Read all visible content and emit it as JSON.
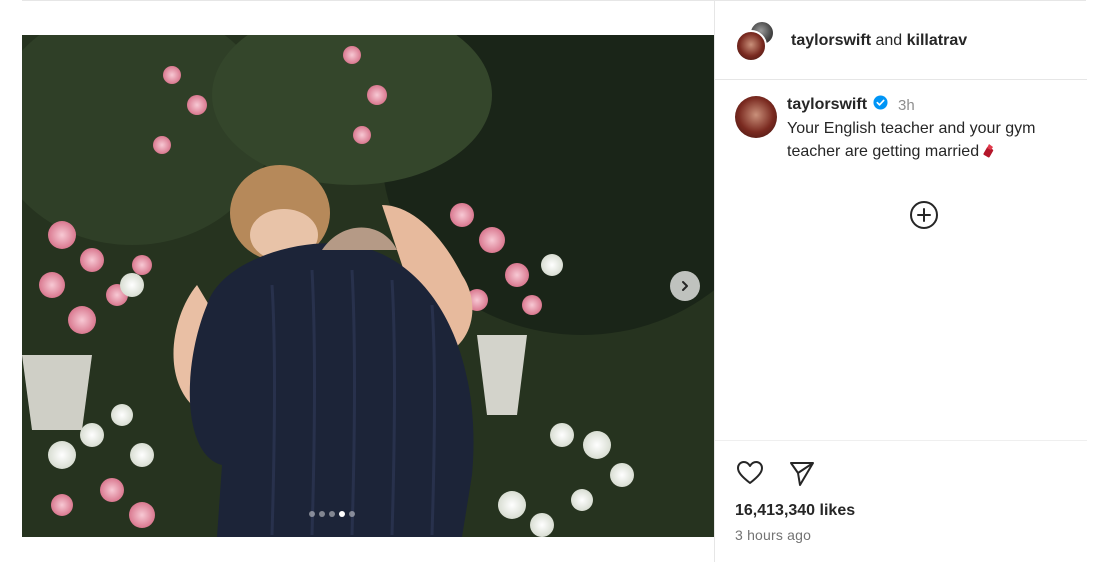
{
  "header": {
    "user1": "taylorswift",
    "conjunction": "and",
    "user2": "killatrav"
  },
  "caption": {
    "username": "taylorswift",
    "verified_icon": "verified-badge-icon",
    "time": "3h",
    "text": "Your English teacher and your gym teacher are getting married",
    "emoji_icon": "lipstick-emoji-icon"
  },
  "media": {
    "carousel_count": 5,
    "carousel_active_index": 3,
    "next_icon": "chevron-right-icon"
  },
  "actions": {
    "like_icon": "heart-icon",
    "share_icon": "paper-plane-icon",
    "more_icon": "plus-circle-icon"
  },
  "likes": "16,413,340 likes",
  "timestamp": "3 hours ago",
  "colors": {
    "verified": "#0095f6",
    "text": "#262626",
    "muted": "#8e8e8e",
    "divider": "#e6e6e6"
  }
}
